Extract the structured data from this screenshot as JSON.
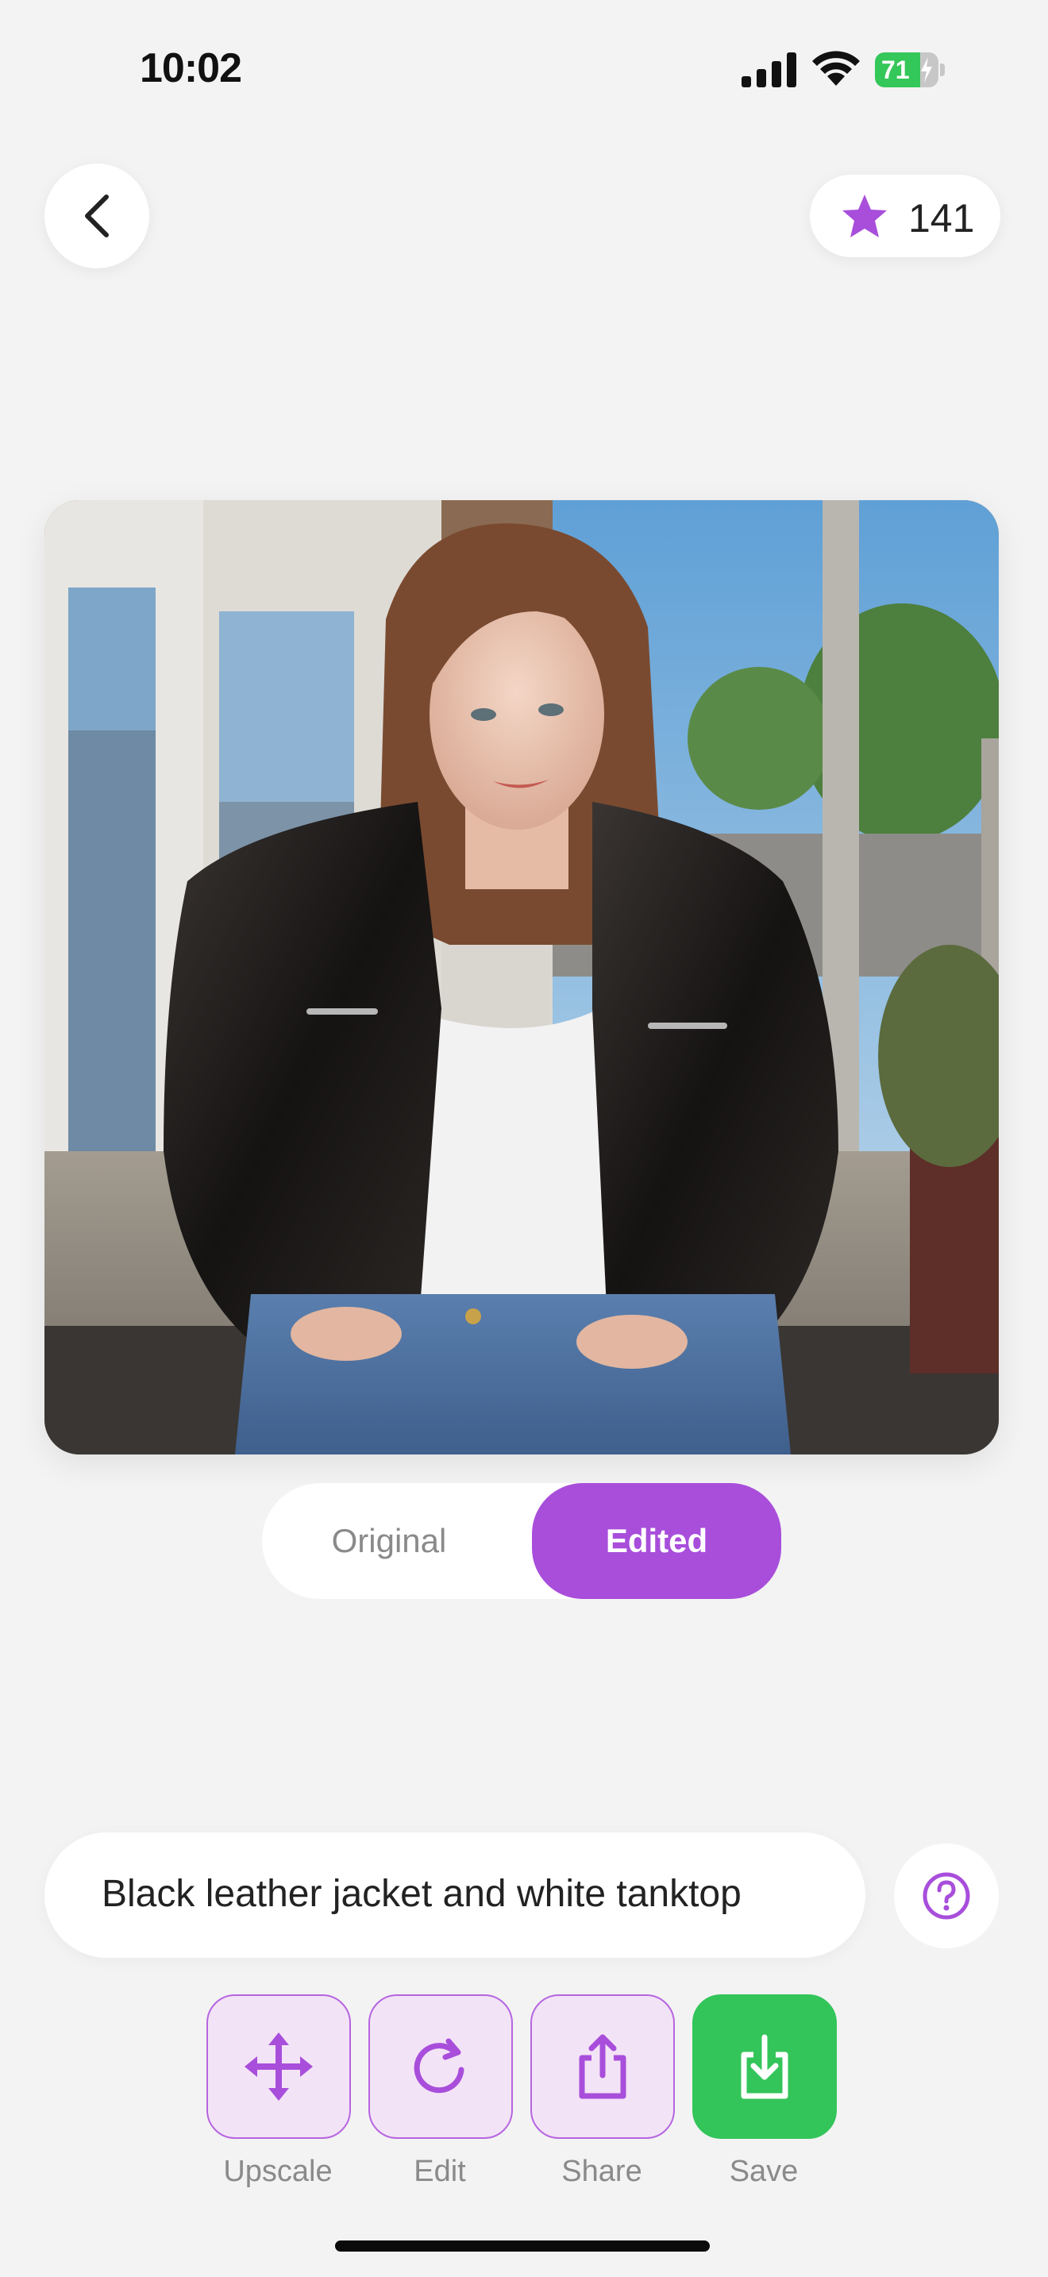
{
  "status_bar": {
    "time": "10:02",
    "battery_level": "71"
  },
  "header": {
    "back_icon": "chevron-left-icon",
    "credits_icon": "star-icon",
    "credits_count": "141"
  },
  "colors": {
    "accent": "#a84edb",
    "save_green": "#33c55a",
    "background": "#f3f3f3"
  },
  "image_view": {
    "toggle": {
      "options": [
        "Original",
        "Edited"
      ],
      "selected": "Edited"
    }
  },
  "prompt": {
    "text": "Black leather jacket and white tanktop",
    "help_icon": "question-circle-icon"
  },
  "actions": [
    {
      "label": "Upscale",
      "icon": "move-arrows-icon"
    },
    {
      "label": "Edit",
      "icon": "refresh-icon"
    },
    {
      "label": "Share",
      "icon": "share-icon"
    },
    {
      "label": "Save",
      "icon": "download-icon"
    }
  ]
}
